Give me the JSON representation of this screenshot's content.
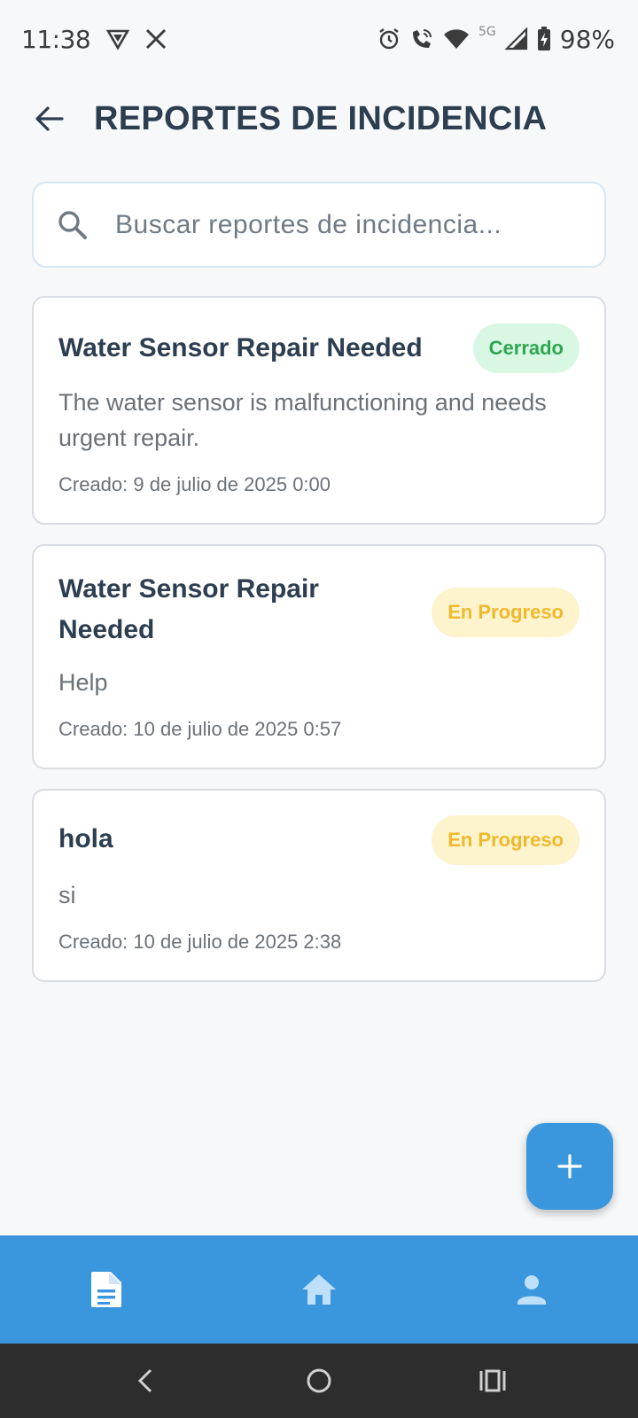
{
  "status_bar": {
    "time": "11:38",
    "battery": "98%",
    "network": "5G",
    "icons": [
      "vpn-shield-icon",
      "x-app-icon",
      "alarm-icon",
      "wifi-calling-icon",
      "wifi-icon",
      "signal-icon",
      "battery-charging-icon"
    ]
  },
  "header": {
    "title": "REPORTES DE INCIDENCIA",
    "back_icon": "arrow-back-icon"
  },
  "search": {
    "placeholder": "Buscar reportes de incidencia...",
    "value": ""
  },
  "reports": [
    {
      "title": "Water Sensor Repair Needed",
      "status": "Cerrado",
      "description": "The water sensor is malfunctioning and needs urgent repair.",
      "created": "Creado: 9 de julio de 2025 0:00"
    },
    {
      "title": "Water Sensor Repair Needed",
      "status": "En Progreso",
      "description": "Help",
      "created": "Creado: 10 de julio de 2025 0:57"
    },
    {
      "title": "hola",
      "status": "En Progreso",
      "description": "si",
      "created": "Creado: 10 de julio de 2025 2:38"
    }
  ],
  "fab": {
    "icon": "plus-icon"
  },
  "bottom_nav": {
    "items": [
      {
        "icon": "document-icon",
        "active": true
      },
      {
        "icon": "home-icon",
        "active": false
      },
      {
        "icon": "person-icon",
        "active": false
      }
    ]
  },
  "colors": {
    "primary": "#3b97dd",
    "title_text": "#2c3e50",
    "closed_bg": "#d9f8e3",
    "closed_text": "#2ea653",
    "progress_bg": "#fdf3cc",
    "progress_text": "#f0b92d"
  }
}
